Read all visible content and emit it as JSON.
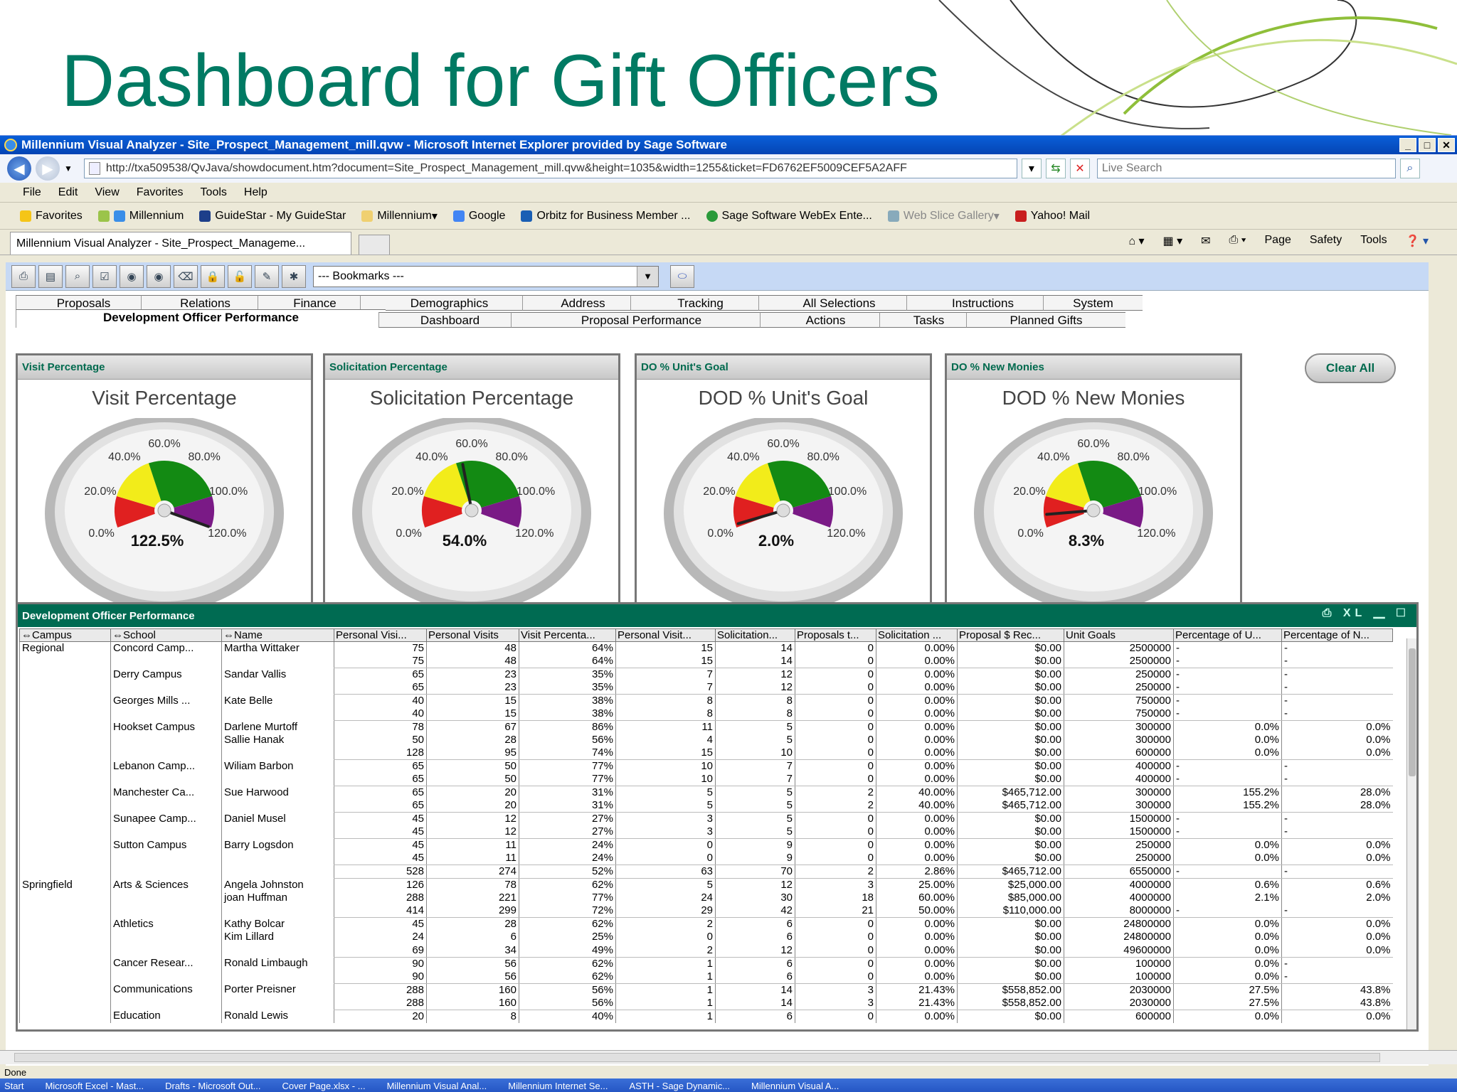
{
  "slide": {
    "title": "Dashboard for Gift Officers"
  },
  "window": {
    "title": "Millennium Visual Analyzer - Site_Prospect_Management_mill.qvw - Microsoft Internet Explorer provided by Sage Software",
    "address": "http://txa509538/QvJava/showdocument.htm?document=Site_Prospect_Management_mill.qvw&height=1035&width=1255&ticket=FD6762EF5009CEF5A2AFF",
    "search_placeholder": "Live Search",
    "menu": [
      "File",
      "Edit",
      "View",
      "Favorites",
      "Tools",
      "Help"
    ],
    "favorites_label": "Favorites",
    "favorites": [
      "Millennium",
      "GuideStar - My GuideStar",
      "Millennium",
      "Google",
      "Orbitz for Business Member ...",
      "Sage Software WebEx Ente...",
      "Web Slice Gallery",
      "Yahoo! Mail"
    ],
    "tab_title": "Millennium Visual Analyzer - Site_Prospect_Manageme...",
    "commands": [
      "Page",
      "Safety",
      "Tools"
    ],
    "status": "Done",
    "taskbar": [
      "Start",
      "Microsoft Excel - Mast...",
      "Drafts - Microsoft Out...",
      "Cover Page.xlsx - ...",
      "Millennium Visual Anal...",
      "Millennium Internet Se...",
      "ASTH - Sage Dynamic...",
      "Millennium Visual A..."
    ]
  },
  "qv": {
    "bookmarks": "--- Bookmarks ---",
    "tabs_row1": [
      "Proposals",
      "Relations",
      "Finance",
      "Demographics",
      "Address",
      "Tracking",
      "All Selections",
      "Instructions",
      "System"
    ],
    "tabs_row2": [
      "Development Officer Performance",
      "Dashboard",
      "Proposal Performance",
      "Actions",
      "Tasks",
      "Planned Gifts"
    ],
    "clear_all": "Clear All",
    "gauges": [
      {
        "caption": "Visit Percentage",
        "title": "Visit Percentage",
        "value": 122.5,
        "display": "122.5%"
      },
      {
        "caption": "Solicitation Percentage",
        "title": "Solicitation Percentage",
        "value": 54.0,
        "display": "54.0%"
      },
      {
        "caption": "DO % Unit's Goal",
        "title": "DOD % Unit's Goal",
        "value": 2.0,
        "display": "2.0%"
      },
      {
        "caption": "DO % New Monies",
        "title": "DOD % New Monies",
        "value": 8.3,
        "display": "8.3%"
      }
    ],
    "gauge_ticks": [
      "0.0%",
      "20.0%",
      "40.0%",
      "60.0%",
      "80.0%",
      "100.0%",
      "120.0%"
    ],
    "gauge_colors": {
      "red": "#e02020",
      "yellow": "#f2ec1a",
      "green": "#138a13",
      "purple": "#7a1a86"
    },
    "table": {
      "caption": "Development Officer Performance",
      "columns": [
        "Campus",
        "School",
        "Name",
        "Personal Visi...",
        "Personal Visits",
        "Visit Percenta...",
        "Personal Visit...",
        "Solicitation...",
        "Proposals t...",
        "Solicitation ...",
        "Proposal $ Rec...",
        "Unit Goals",
        "Percentage of U...",
        "Percentage of N..."
      ],
      "rows": [
        [
          "Regional",
          "Concord Camp...",
          "Martha Wittaker",
          "75",
          "48",
          "64%",
          "15",
          "14",
          "0",
          "0.00%",
          "$0.00",
          "2500000",
          "-",
          "-"
        ],
        [
          "",
          "",
          "",
          "75",
          "48",
          "64%",
          "15",
          "14",
          "0",
          "0.00%",
          "$0.00",
          "2500000",
          "-",
          "-"
        ],
        [
          "",
          "Derry Campus",
          "Sandar Vallis",
          "65",
          "23",
          "35%",
          "7",
          "12",
          "0",
          "0.00%",
          "$0.00",
          "250000",
          "-",
          "-"
        ],
        [
          "",
          "",
          "",
          "65",
          "23",
          "35%",
          "7",
          "12",
          "0",
          "0.00%",
          "$0.00",
          "250000",
          "-",
          "-"
        ],
        [
          "",
          "Georges Mills ...",
          "Kate Belle",
          "40",
          "15",
          "38%",
          "8",
          "8",
          "0",
          "0.00%",
          "$0.00",
          "750000",
          "-",
          "-"
        ],
        [
          "",
          "",
          "",
          "40",
          "15",
          "38%",
          "8",
          "8",
          "0",
          "0.00%",
          "$0.00",
          "750000",
          "-",
          "-"
        ],
        [
          "",
          "Hookset Campus",
          "Darlene Murtoff",
          "78",
          "67",
          "86%",
          "11",
          "5",
          "0",
          "0.00%",
          "$0.00",
          "300000",
          "0.0%",
          "0.0%"
        ],
        [
          "",
          "",
          "Sallie Hanak",
          "50",
          "28",
          "56%",
          "4",
          "5",
          "0",
          "0.00%",
          "$0.00",
          "300000",
          "0.0%",
          "0.0%"
        ],
        [
          "",
          "",
          "",
          "128",
          "95",
          "74%",
          "15",
          "10",
          "0",
          "0.00%",
          "$0.00",
          "600000",
          "0.0%",
          "0.0%"
        ],
        [
          "",
          "Lebanon Camp...",
          "Wiliam Barbon",
          "65",
          "50",
          "77%",
          "10",
          "7",
          "0",
          "0.00%",
          "$0.00",
          "400000",
          "-",
          "-"
        ],
        [
          "",
          "",
          "",
          "65",
          "50",
          "77%",
          "10",
          "7",
          "0",
          "0.00%",
          "$0.00",
          "400000",
          "-",
          "-"
        ],
        [
          "",
          "Manchester Ca...",
          "Sue Harwood",
          "65",
          "20",
          "31%",
          "5",
          "5",
          "2",
          "40.00%",
          "$465,712.00",
          "300000",
          "155.2%",
          "28.0%"
        ],
        [
          "",
          "",
          "",
          "65",
          "20",
          "31%",
          "5",
          "5",
          "2",
          "40.00%",
          "$465,712.00",
          "300000",
          "155.2%",
          "28.0%"
        ],
        [
          "",
          "Sunapee Camp...",
          "Daniel Musel",
          "45",
          "12",
          "27%",
          "3",
          "5",
          "0",
          "0.00%",
          "$0.00",
          "1500000",
          "-",
          "-"
        ],
        [
          "",
          "",
          "",
          "45",
          "12",
          "27%",
          "3",
          "5",
          "0",
          "0.00%",
          "$0.00",
          "1500000",
          "-",
          "-"
        ],
        [
          "",
          "Sutton Campus",
          "Barry Logsdon",
          "45",
          "11",
          "24%",
          "0",
          "9",
          "0",
          "0.00%",
          "$0.00",
          "250000",
          "0.0%",
          "0.0%"
        ],
        [
          "",
          "",
          "",
          "45",
          "11",
          "24%",
          "0",
          "9",
          "0",
          "0.00%",
          "$0.00",
          "250000",
          "0.0%",
          "0.0%"
        ],
        [
          "",
          "",
          "",
          "528",
          "274",
          "52%",
          "63",
          "70",
          "2",
          "2.86%",
          "$465,712.00",
          "6550000",
          "-",
          "-"
        ],
        [
          "Springfield",
          "Arts & Sciences",
          "Angela Johnston",
          "126",
          "78",
          "62%",
          "5",
          "12",
          "3",
          "25.00%",
          "$25,000.00",
          "4000000",
          "0.6%",
          "0.6%"
        ],
        [
          "",
          "",
          "joan Huffman",
          "288",
          "221",
          "77%",
          "24",
          "30",
          "18",
          "60.00%",
          "$85,000.00",
          "4000000",
          "2.1%",
          "2.0%"
        ],
        [
          "",
          "",
          "",
          "414",
          "299",
          "72%",
          "29",
          "42",
          "21",
          "50.00%",
          "$110,000.00",
          "8000000",
          "-",
          "-"
        ],
        [
          "",
          "Athletics",
          "Kathy Bolcar",
          "45",
          "28",
          "62%",
          "2",
          "6",
          "0",
          "0.00%",
          "$0.00",
          "24800000",
          "0.0%",
          "0.0%"
        ],
        [
          "",
          "",
          "Kim Lillard",
          "24",
          "6",
          "25%",
          "0",
          "6",
          "0",
          "0.00%",
          "$0.00",
          "24800000",
          "0.0%",
          "0.0%"
        ],
        [
          "",
          "",
          "",
          "69",
          "34",
          "49%",
          "2",
          "12",
          "0",
          "0.00%",
          "$0.00",
          "49600000",
          "0.0%",
          "0.0%"
        ],
        [
          "",
          "Cancer Resear...",
          "Ronald Limbaugh",
          "90",
          "56",
          "62%",
          "1",
          "6",
          "0",
          "0.00%",
          "$0.00",
          "100000",
          "0.0%",
          "-"
        ],
        [
          "",
          "",
          "",
          "90",
          "56",
          "62%",
          "1",
          "6",
          "0",
          "0.00%",
          "$0.00",
          "100000",
          "0.0%",
          "-"
        ],
        [
          "",
          "Communications",
          "Porter Preisner",
          "288",
          "160",
          "56%",
          "1",
          "14",
          "3",
          "21.43%",
          "$558,852.00",
          "2030000",
          "27.5%",
          "43.8%"
        ],
        [
          "",
          "",
          "",
          "288",
          "160",
          "56%",
          "1",
          "14",
          "3",
          "21.43%",
          "$558,852.00",
          "2030000",
          "27.5%",
          "43.8%"
        ],
        [
          "",
          "Education",
          "Ronald Lewis",
          "20",
          "8",
          "40%",
          "1",
          "6",
          "0",
          "0.00%",
          "$0.00",
          "600000",
          "0.0%",
          "0.0%"
        ]
      ]
    }
  }
}
